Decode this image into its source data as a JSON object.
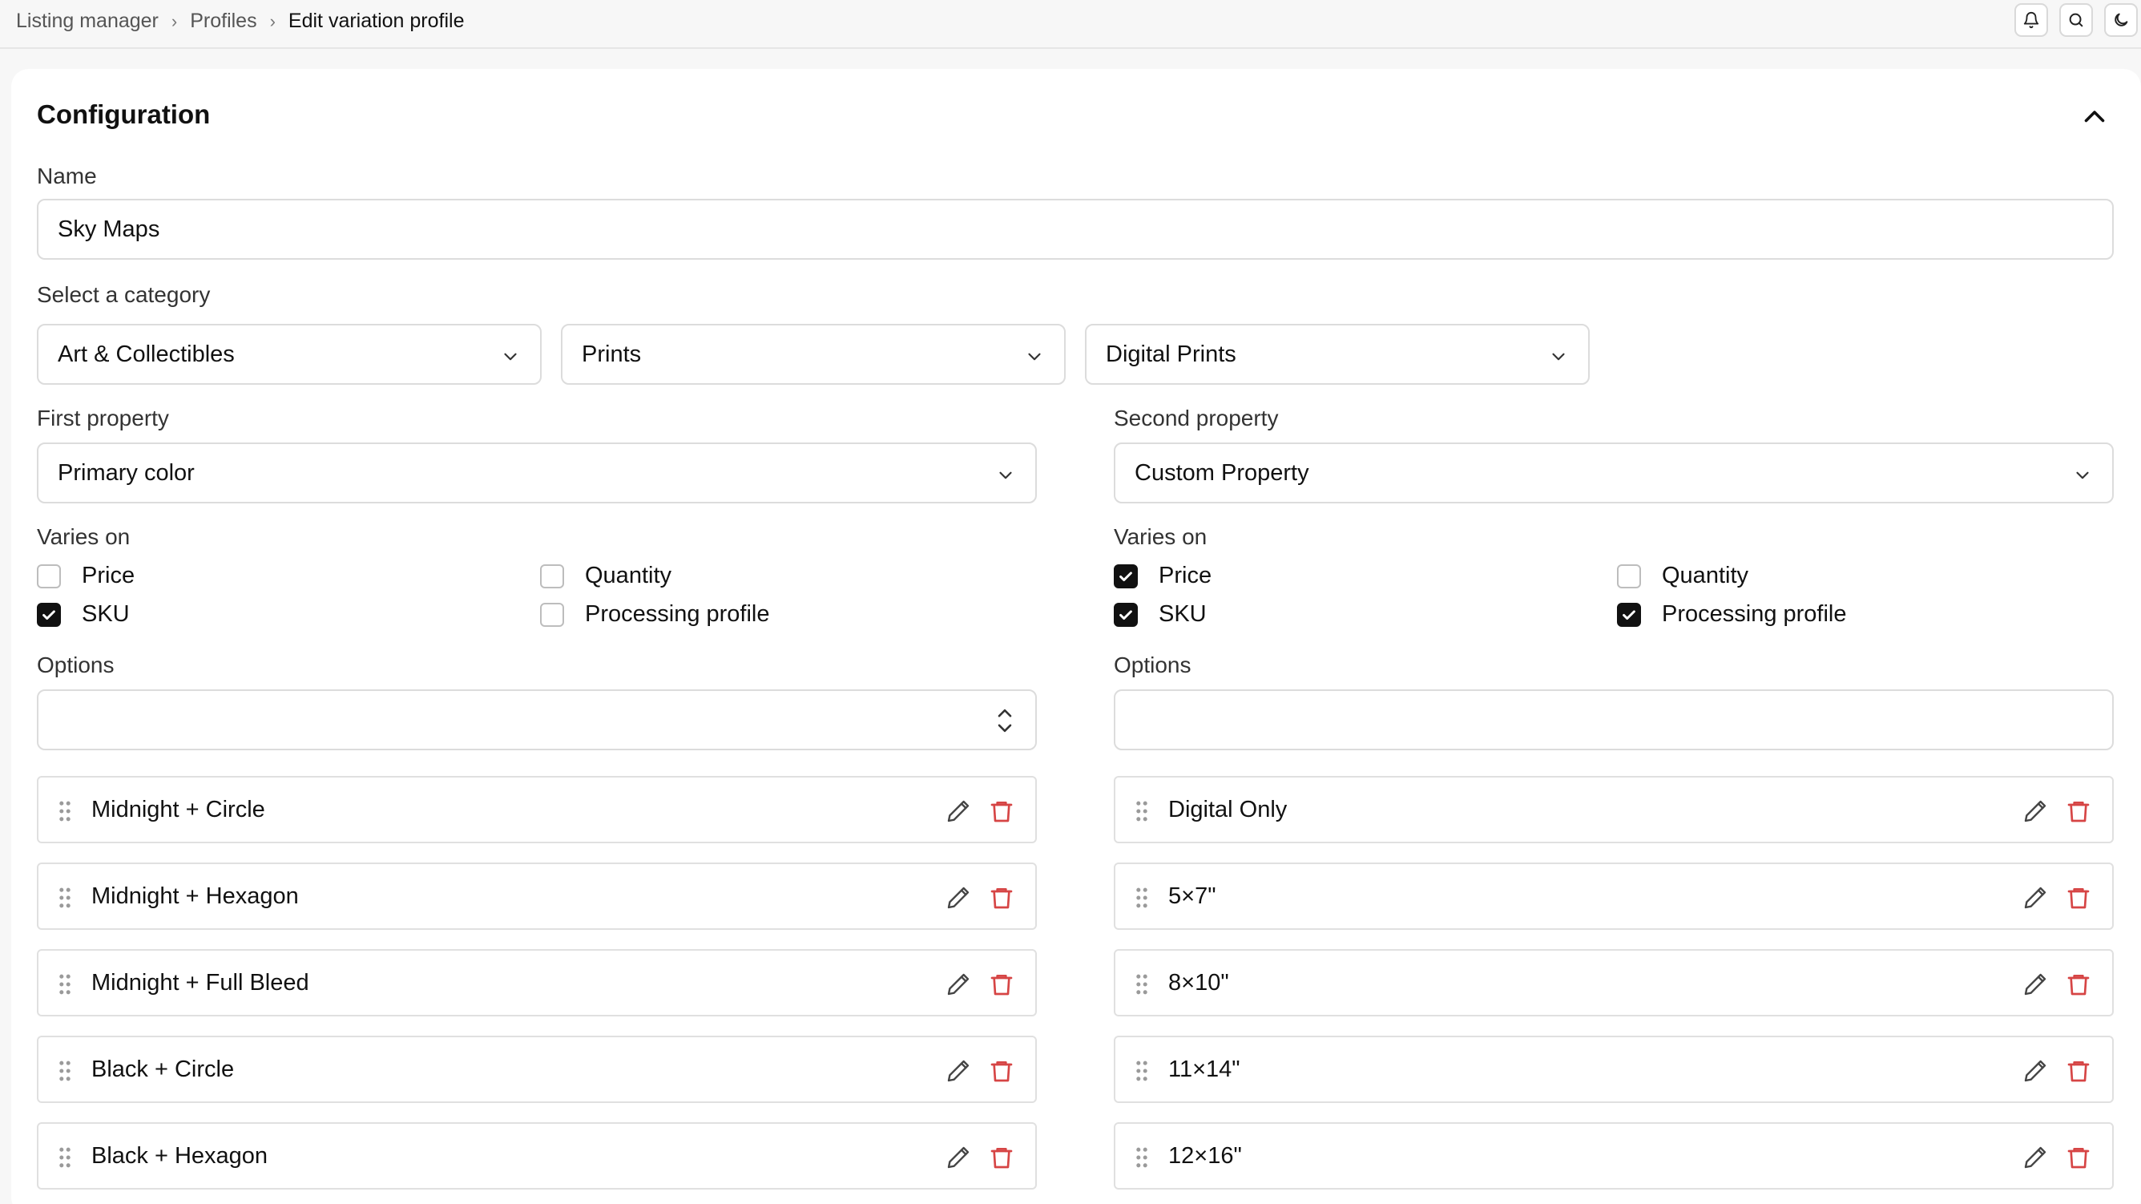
{
  "breadcrumb": {
    "items": [
      "Listing manager",
      "Profiles",
      "Edit variation profile"
    ]
  },
  "topbar": {
    "icons": [
      "bell-icon",
      "search-icon",
      "moon-icon"
    ]
  },
  "config": {
    "title": "Configuration",
    "name_label": "Name",
    "name_value": "Sky Maps",
    "category_label": "Select a category",
    "categories": [
      "Art & Collectibles",
      "Prints",
      "Digital Prints"
    ]
  },
  "first": {
    "property_label": "First property",
    "property_value": "Primary color",
    "varies_label": "Varies on",
    "checks": [
      {
        "label": "Price",
        "checked": false
      },
      {
        "label": "Quantity",
        "checked": false
      },
      {
        "label": "SKU",
        "checked": true
      },
      {
        "label": "Processing profile",
        "checked": false
      }
    ],
    "options_label": "Options",
    "options_value": "",
    "options": [
      "Midnight + Circle",
      "Midnight + Hexagon",
      "Midnight + Full Bleed",
      "Black + Circle",
      "Black + Hexagon"
    ]
  },
  "second": {
    "property_label": "Second property",
    "property_value": "Custom Property",
    "varies_label": "Varies on",
    "checks": [
      {
        "label": "Price",
        "checked": true
      },
      {
        "label": "Quantity",
        "checked": false
      },
      {
        "label": "SKU",
        "checked": true
      },
      {
        "label": "Processing profile",
        "checked": true
      }
    ],
    "options_label": "Options",
    "options_value": "",
    "options": [
      "Digital Only",
      "5×7\"",
      "8×10\"",
      "11×14\"",
      "12×16\""
    ]
  },
  "colors": {
    "accent": "#111111",
    "danger": "#d64545",
    "border": "#dcdcdc",
    "background": "#f7f7f7"
  }
}
